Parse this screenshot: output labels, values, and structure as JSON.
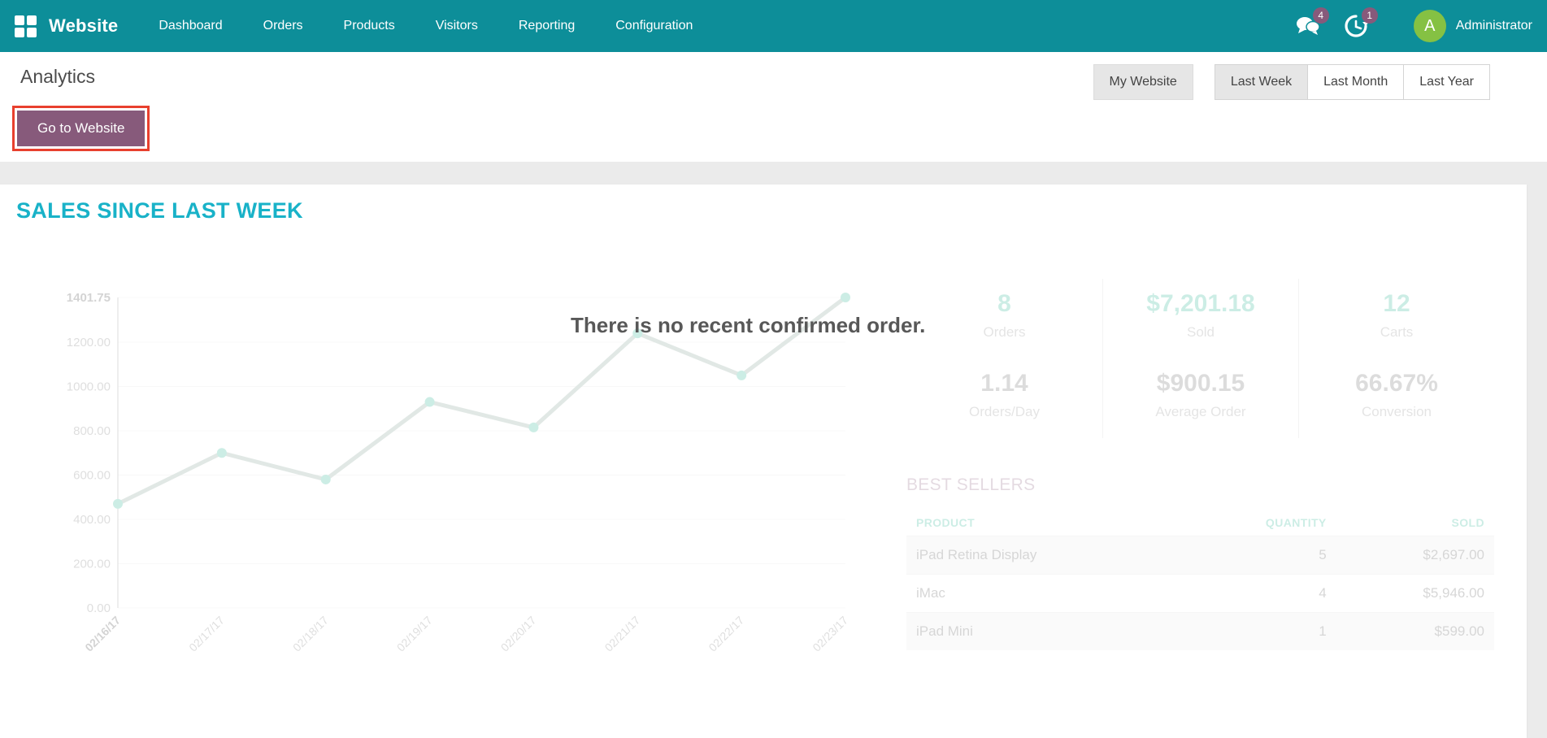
{
  "navbar": {
    "brand": "Website",
    "menu_items": [
      "Dashboard",
      "Orders",
      "Products",
      "Visitors",
      "Reporting",
      "Configuration"
    ],
    "messages": {
      "icon": "chat-bubbles-icon",
      "badge": "4"
    },
    "activities": {
      "icon": "activity-clock-icon",
      "badge": "1"
    },
    "user": {
      "initial": "A",
      "name": "Administrator"
    }
  },
  "control_panel": {
    "title": "Analytics",
    "primary_button": "Go to Website",
    "website_switcher": "My Website",
    "range_buttons": [
      {
        "label": "Last Week",
        "active": true
      },
      {
        "label": "Last Month",
        "active": false
      },
      {
        "label": "Last Year",
        "active": false
      }
    ]
  },
  "dashboard": {
    "section_title": "SALES SINCE LAST WEEK",
    "empty_message": "There is no recent confirmed order.",
    "stats": [
      {
        "value": "8",
        "label": "Orders",
        "accent": true
      },
      {
        "value": "$7,201.18",
        "label": "Sold",
        "accent": true
      },
      {
        "value": "12",
        "label": "Carts",
        "accent": true
      },
      {
        "value": "1.14",
        "label": "Orders/Day",
        "accent": false
      },
      {
        "value": "$900.15",
        "label": "Average Order",
        "accent": false
      },
      {
        "value": "66.67%",
        "label": "Conversion",
        "accent": false
      }
    ],
    "best_sellers": {
      "title": "BEST SELLERS",
      "columns": [
        "PRODUCT",
        "QUANTITY",
        "SOLD"
      ],
      "rows": [
        {
          "product": "iPad Retina Display",
          "quantity": "5",
          "sold": "$2,697.00"
        },
        {
          "product": "iMac",
          "quantity": "4",
          "sold": "$5,946.00"
        },
        {
          "product": "iPad Mini",
          "quantity": "1",
          "sold": "$599.00"
        }
      ]
    }
  },
  "chart_data": {
    "type": "line",
    "title": "SALES SINCE LAST WEEK",
    "x": [
      "02/16/17",
      "02/17/17",
      "02/18/17",
      "02/19/17",
      "02/20/17",
      "02/21/17",
      "02/22/17",
      "02/23/17"
    ],
    "values": [
      470,
      700,
      580,
      930,
      815,
      1240,
      1050,
      1401.75
    ],
    "ylim": [
      0,
      1401.75
    ],
    "y_ticks": [
      0,
      200,
      400,
      600,
      800,
      1000,
      1200,
      1401.75
    ],
    "y_tick_labels": [
      "0.00",
      "200.00",
      "400.00",
      "600.00",
      "800.00",
      "1000.00",
      "1200.00",
      "1401.75"
    ],
    "xlabel": "",
    "ylabel": "",
    "grid": true,
    "legend": false
  },
  "colors": {
    "navbar_teal": "#0d8e99",
    "accent_cyan": "#19b2c8",
    "primary_purple": "#875a7b",
    "annotation_red": "#e8402e",
    "badge_purple": "#875a7b",
    "avatar_green": "#85c143",
    "chart_teal": "#1cb28d"
  }
}
